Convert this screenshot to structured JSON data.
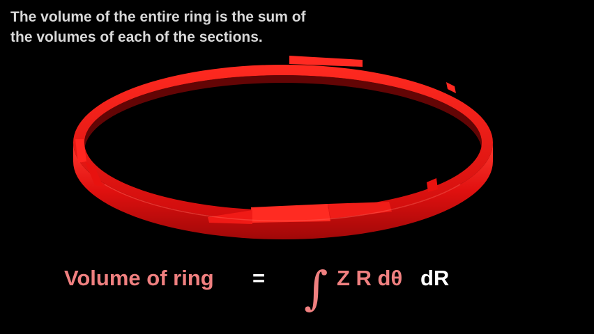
{
  "caption": {
    "line1": "The volume of the entire ring is the sum of",
    "line2": "the volumes of each of the sections."
  },
  "formula": {
    "lhs": "Volume of ring",
    "equals": "=",
    "integral_sign": "∫",
    "integrand": "Z R dθ",
    "differential": "dR"
  },
  "colors": {
    "background": "#000000",
    "ring": "#e0100f",
    "formula_accent": "#f08080",
    "formula_white": "#ffffff",
    "caption_text": "#d8d8d8"
  }
}
